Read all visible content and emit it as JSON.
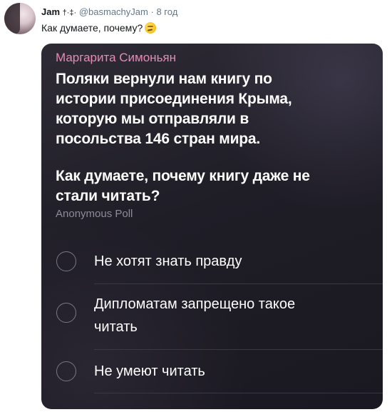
{
  "tweet": {
    "author_name": "Jam",
    "author_symbols": "†·‡·",
    "handle": "@basmachyJam",
    "separator": "·",
    "time": "8 год",
    "text": "Как думаете, почему?"
  },
  "poll": {
    "author": "Маргарита Симоньян",
    "question_line1": "Поляки вернули нам книгу по",
    "question_line2": "истории присоединения Крыма,",
    "question_line3": "которую мы отправляли в",
    "question_line4": "посольства 146 стран мира.",
    "question_line5": "Как думаете, почему книгу даже не",
    "question_line6": "стали читать?",
    "type_label": "Anonymous Poll",
    "options": [
      {
        "line1": "Не хотят знать правду",
        "line2": ""
      },
      {
        "line1": "Дипломатам запрещено такое",
        "line2": "читать"
      },
      {
        "line1": "Не умеют читать",
        "line2": ""
      }
    ]
  },
  "colors": {
    "author_pink": "#e988b9",
    "card_bg": "#1f1d26",
    "secondary_text": "#8e8c99"
  },
  "icons": {
    "emoji": "thinking-face-icon",
    "radio": "radio-circle-icon"
  }
}
